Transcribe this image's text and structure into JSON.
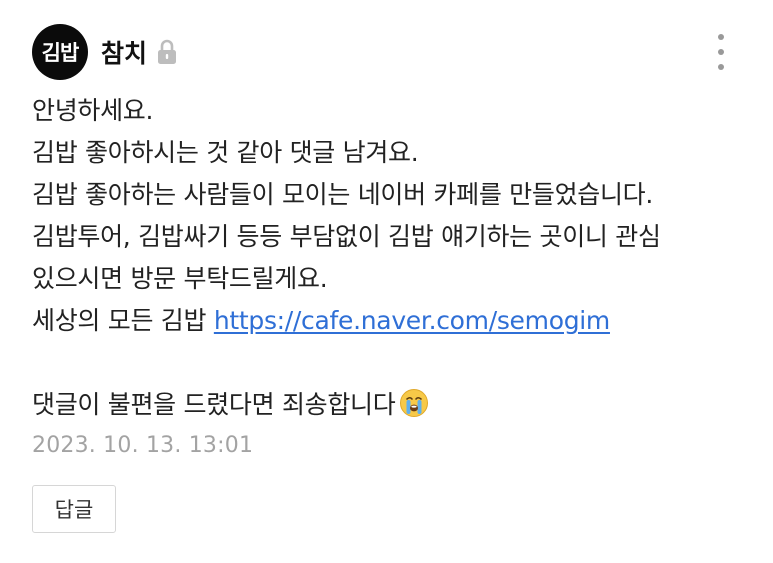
{
  "author": {
    "avatar_text": "김밥",
    "name": "참치",
    "lock_icon": "lock-icon"
  },
  "menu": {
    "icon": "more-vertical-icon"
  },
  "comment": {
    "lines": [
      "안녕하세요.",
      "김밥 좋아하시는 것 같아 댓글 남겨요.",
      "김밥 좋아하는 사람들이 모이는 네이버 카페를 만들었습니다.",
      "김밥투어, 김밥싸기 등등 부담없이 김밥 얘기하는 곳이니 관심",
      "있으시면 방문 부탁드릴게요."
    ],
    "link_prefix": "세상의 모든 김밥 ",
    "link_text": "https://cafe.naver.com/semogim",
    "closing_text": "댓글이 불편을 드렸다면 죄송합니다",
    "emoji_icon": "crying-face-emoji"
  },
  "timestamp": "2023. 10. 13. 13:01",
  "reply_label": "답글",
  "colors": {
    "link": "#2f6fd6",
    "timestamp": "#a3a3a3",
    "avatar_bg": "#0b0b0b"
  }
}
